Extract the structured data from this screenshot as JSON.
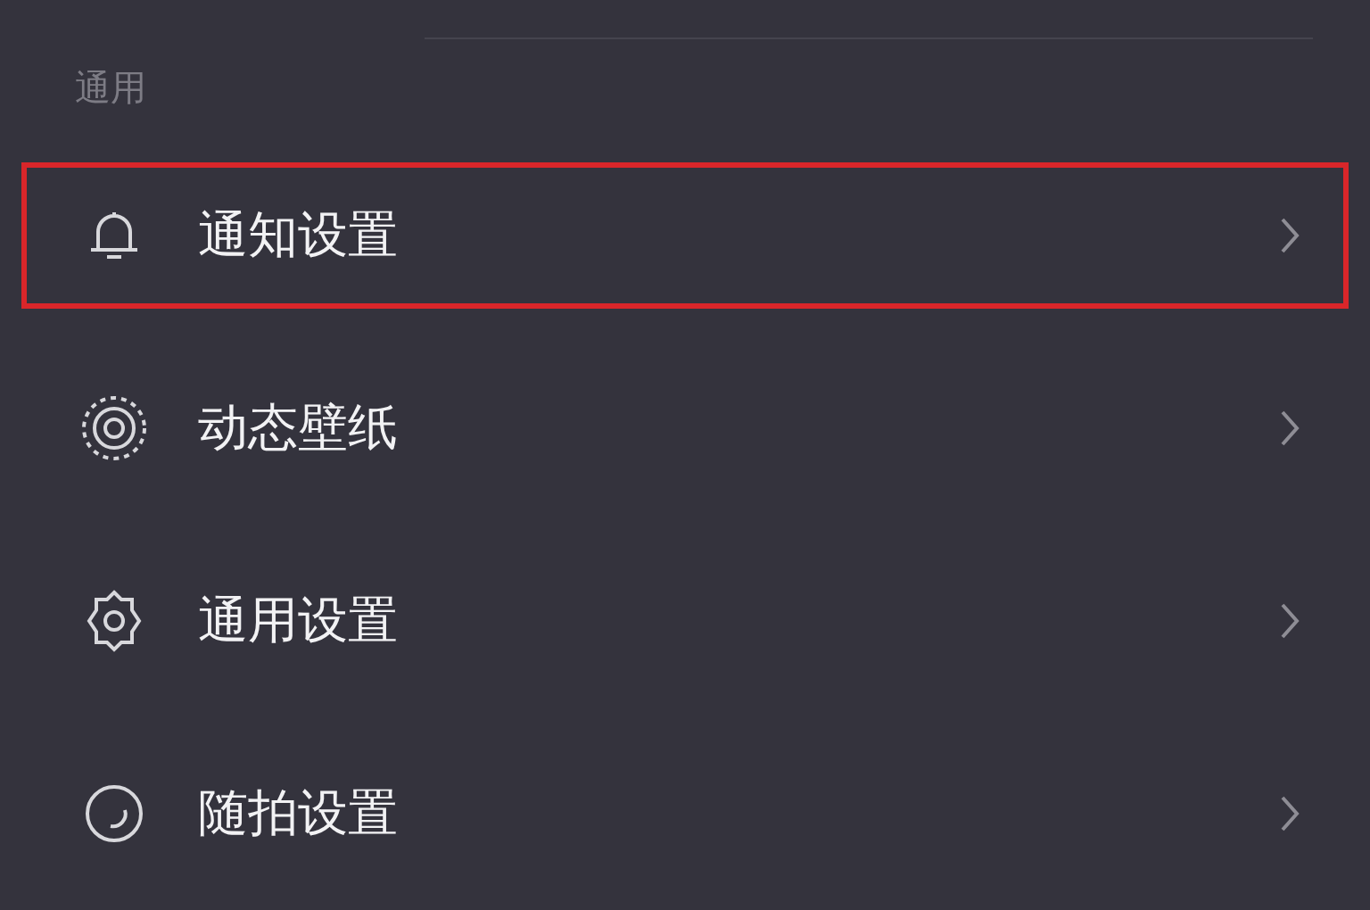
{
  "section": {
    "title": "通用"
  },
  "items": [
    {
      "label": "通知设置",
      "highlighted": true
    },
    {
      "label": "动态壁纸",
      "highlighted": false
    },
    {
      "label": "通用设置",
      "highlighted": false
    },
    {
      "label": "随拍设置",
      "highlighted": false
    }
  ]
}
